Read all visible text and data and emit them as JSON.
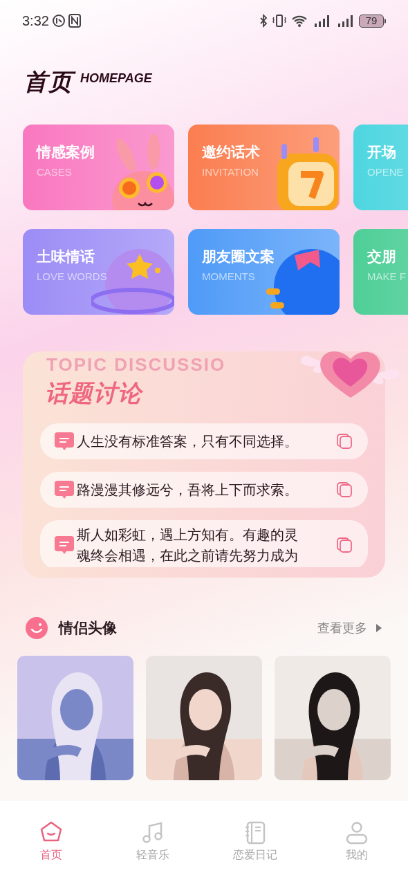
{
  "status_bar": {
    "time": "3:32",
    "battery": "79"
  },
  "header": {
    "title": "首页",
    "subtitle": "HOMEPAGE"
  },
  "categories": [
    {
      "title": "情感案例",
      "subtitle": "CASES",
      "color": "#f978c0",
      "kind": "bunny"
    },
    {
      "title": "邀约话术",
      "subtitle": "INVITATION",
      "color": "#fb7e50",
      "kind": "calendar"
    },
    {
      "title": "开场",
      "subtitle": "OPENE",
      "color": "#4fd6e0",
      "kind": "none"
    },
    {
      "title": "土味情话",
      "subtitle": "LOVE WORDS",
      "color": "#9c8cf6",
      "kind": "planet"
    },
    {
      "title": "朋友圈文案",
      "subtitle": "MOMENTS",
      "color": "#4f9bf8",
      "kind": "bubble"
    },
    {
      "title": "交朋",
      "subtitle": "MAKE F",
      "color": "#4fcf98",
      "kind": "none"
    }
  ],
  "topic": {
    "title": "话题讨论",
    "watermark": "TOPIC DISCUSSIO",
    "items": [
      {
        "text": "人生没有标准答案，只有不同选择。"
      },
      {
        "text": "路漫漫其修远兮，吾将上下而求索。"
      },
      {
        "text": "斯人如彩虹，遇上方知有。有趣的灵魂终会相遇，在此之前请先努力成为"
      }
    ]
  },
  "avatars": {
    "title": "情侣头像",
    "more": "查看更多"
  },
  "nav": [
    {
      "label": "首页",
      "selected": true,
      "kind": "home"
    },
    {
      "label": "轻音乐",
      "selected": false,
      "kind": "music"
    },
    {
      "label": "恋爱日记",
      "selected": false,
      "kind": "diary"
    },
    {
      "label": "我的",
      "selected": false,
      "kind": "user"
    }
  ]
}
